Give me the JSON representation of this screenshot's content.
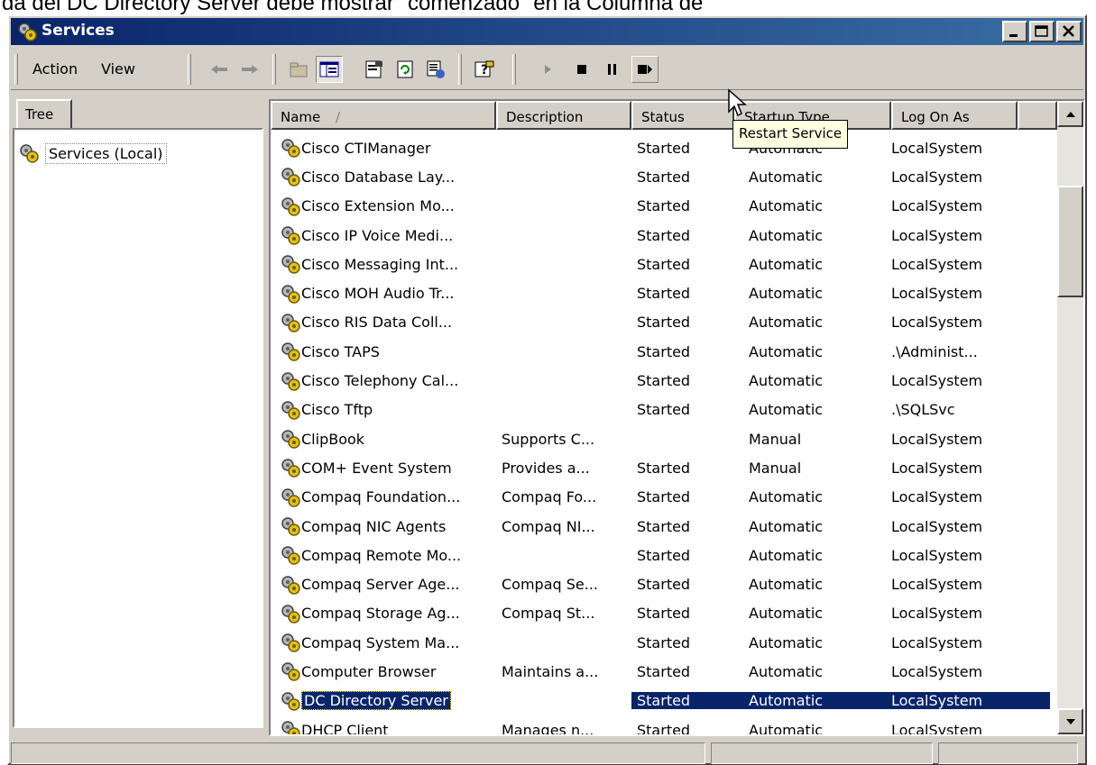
{
  "caption": "da del DC Directory Server debe mostrar \"comenzado\" en la Columna de",
  "window": {
    "title": "Services"
  },
  "menu": {
    "action": "Action",
    "view": "View"
  },
  "toolbar": {
    "icons": [
      "back-arrow-icon",
      "forward-arrow-icon",
      "up-folder-icon",
      "show-hide-tree-icon",
      "properties-icon",
      "refresh-icon",
      "export-list-icon",
      "help-icon",
      "start-service-icon",
      "stop-service-icon",
      "pause-service-icon",
      "restart-service-icon"
    ]
  },
  "tree": {
    "tab_label": "Tree",
    "root_label": "Services (Local)"
  },
  "list": {
    "columns": [
      "Name",
      "Description",
      "Status",
      "Startup Type",
      "Log On As"
    ],
    "rows": [
      {
        "name": "Cisco CTIManager",
        "description": "",
        "status": "Started",
        "startup": "Automatic",
        "logon": "LocalSystem"
      },
      {
        "name": "Cisco Database Lay...",
        "description": "",
        "status": "Started",
        "startup": "Automatic",
        "logon": "LocalSystem"
      },
      {
        "name": "Cisco Extension Mo...",
        "description": "",
        "status": "Started",
        "startup": "Automatic",
        "logon": "LocalSystem"
      },
      {
        "name": "Cisco IP Voice Medi...",
        "description": "",
        "status": "Started",
        "startup": "Automatic",
        "logon": "LocalSystem"
      },
      {
        "name": "Cisco Messaging Int...",
        "description": "",
        "status": "Started",
        "startup": "Automatic",
        "logon": "LocalSystem"
      },
      {
        "name": "Cisco MOH Audio Tr...",
        "description": "",
        "status": "Started",
        "startup": "Automatic",
        "logon": "LocalSystem"
      },
      {
        "name": "Cisco RIS Data Coll...",
        "description": "",
        "status": "Started",
        "startup": "Automatic",
        "logon": "LocalSystem"
      },
      {
        "name": "Cisco TAPS",
        "description": "",
        "status": "Started",
        "startup": "Automatic",
        "logon": ".\\Administ..."
      },
      {
        "name": "Cisco Telephony Cal...",
        "description": "",
        "status": "Started",
        "startup": "Automatic",
        "logon": "LocalSystem"
      },
      {
        "name": "Cisco Tftp",
        "description": "",
        "status": "Started",
        "startup": "Automatic",
        "logon": ".\\SQLSvc"
      },
      {
        "name": "ClipBook",
        "description": "Supports C...",
        "status": "",
        "startup": "Manual",
        "logon": "LocalSystem"
      },
      {
        "name": "COM+ Event System",
        "description": "Provides a...",
        "status": "Started",
        "startup": "Manual",
        "logon": "LocalSystem"
      },
      {
        "name": "Compaq Foundation...",
        "description": "Compaq Fo...",
        "status": "Started",
        "startup": "Automatic",
        "logon": "LocalSystem"
      },
      {
        "name": "Compaq NIC Agents",
        "description": "Compaq NI...",
        "status": "Started",
        "startup": "Automatic",
        "logon": "LocalSystem"
      },
      {
        "name": "Compaq Remote Mo...",
        "description": "",
        "status": "Started",
        "startup": "Automatic",
        "logon": "LocalSystem"
      },
      {
        "name": "Compaq Server Age...",
        "description": "Compaq Se...",
        "status": "Started",
        "startup": "Automatic",
        "logon": "LocalSystem"
      },
      {
        "name": "Compaq Storage Ag...",
        "description": "Compaq St...",
        "status": "Started",
        "startup": "Automatic",
        "logon": "LocalSystem"
      },
      {
        "name": "Compaq System Ma...",
        "description": "",
        "status": "Started",
        "startup": "Automatic",
        "logon": "LocalSystem"
      },
      {
        "name": "Computer Browser",
        "description": "Maintains a...",
        "status": "Started",
        "startup": "Automatic",
        "logon": "LocalSystem"
      },
      {
        "name": "DC Directory Server",
        "description": "",
        "status": "Started",
        "startup": "Automatic",
        "logon": "LocalSystem",
        "selected": true
      },
      {
        "name": "DHCP Client",
        "description": "Manages n...",
        "status": "Started",
        "startup": "Automatic",
        "logon": "LocalSystem"
      }
    ]
  },
  "tooltip": "Restart Service",
  "colors": {
    "titlebar_start": "#0a246a",
    "titlebar_end": "#3a6ea5",
    "selection": "#0a246a",
    "face": "#d4d0c8",
    "tooltip_bg": "#ffffe1"
  }
}
